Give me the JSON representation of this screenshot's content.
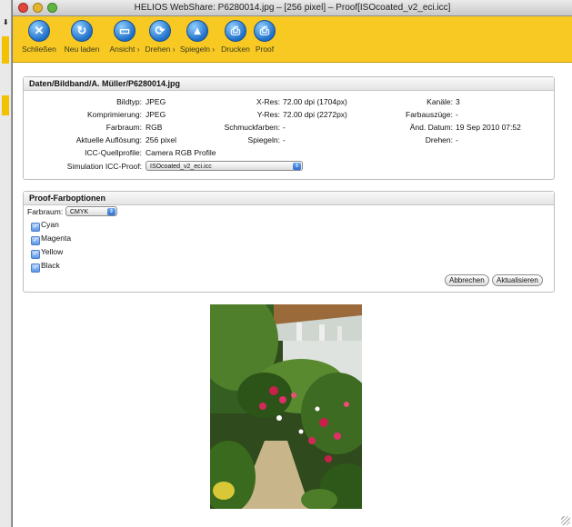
{
  "window": {
    "title": "HELIOS WebShare: P6280014.jpg – [256 pixel] – Proof[ISOcoated_v2_eci.icc]"
  },
  "toolbar": {
    "buttons": [
      {
        "label": "Schließen",
        "icon": "close-icon"
      },
      {
        "label": "Neu laden",
        "icon": "reload-icon"
      },
      {
        "label": "Ansicht ›",
        "icon": "view-icon"
      },
      {
        "label": "Drehen ›",
        "icon": "rotate-icon"
      },
      {
        "label": "Spiegeln ›",
        "icon": "mirror-icon"
      },
      {
        "label": "Drucken",
        "icon": "print-icon"
      },
      {
        "label": "Proof",
        "icon": "proof-icon"
      }
    ]
  },
  "info": {
    "header": "Daten/Bildband/A. Müller/P6280014.jpg",
    "bildtyp_k": "Bildtyp:",
    "bildtyp_v": "JPEG",
    "komp_k": "Komprimierung:",
    "komp_v": "JPEG",
    "farbraum_k": "Farbraum:",
    "farbraum_v": "RGB",
    "aufl_k": "Aktuelle Auflösung:",
    "aufl_v": "256 pixel",
    "icc_k": "ICC-Quellprofile:",
    "icc_v": "Camera RGB Profile",
    "sim_k": "Simulation ICC-Proof:",
    "sim_v": "ISOcoated_v2_eci.icc",
    "xres_k": "X-Res:",
    "xres_v": "72.00 dpi (1704px)",
    "yres_k": "Y-Res:",
    "yres_v": "72.00 dpi (2272px)",
    "schmuck_k": "Schmuckfarben:",
    "schmuck_v": "-",
    "spiegeln_k": "Spiegeln:",
    "spiegeln_v": "-",
    "kanaele_k": "Kanäle:",
    "kanaele_v": "3",
    "farbausz_k": "Farbauszüge:",
    "farbausz_v": "-",
    "datum_k": "Änd. Datum:",
    "datum_v": "19 Sep 2010 07:52",
    "drehen_k": "Drehen:",
    "drehen_v": "-"
  },
  "proof": {
    "header": "Proof-Farboptionen",
    "farbraum_label": "Farbraum:",
    "farbraum_value": "CMYK",
    "channels": [
      "Cyan",
      "Magenta",
      "Yellow",
      "Black"
    ],
    "cancel": "Abbrechen",
    "update": "Aktualisieren"
  },
  "colors": {
    "toolbar": "#f7c922",
    "accent": "#2e6fcf"
  }
}
